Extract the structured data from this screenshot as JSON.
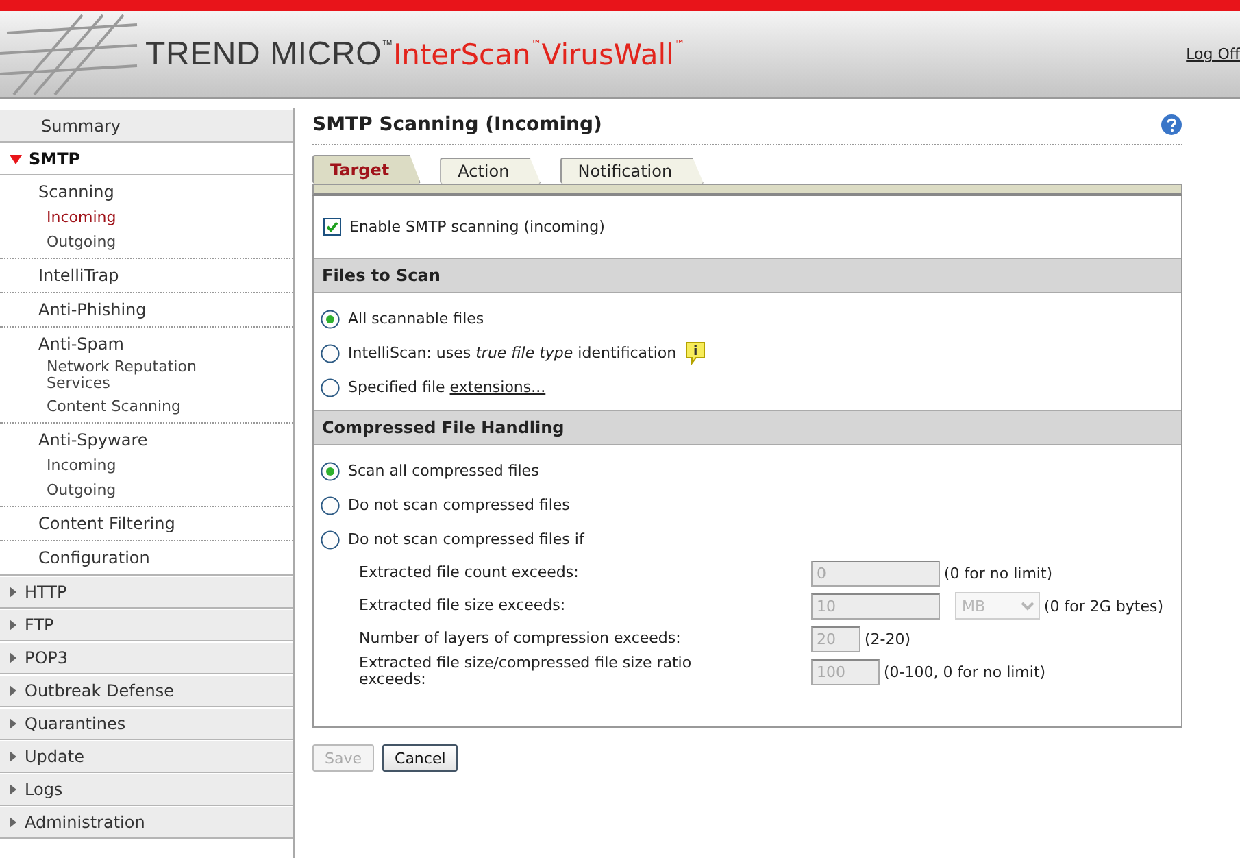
{
  "header": {
    "brand": "TREND MICRO$^{™}$",
    "product": "InterScan$^{™}$VirusWall$^{™}$",
    "log_off": "Log Off"
  },
  "sidebar": {
    "items": [
      {
        "label": "Summary",
        "kind": "page"
      },
      {
        "label": "SMTP",
        "kind": "section",
        "expanded": true,
        "children": [
          {
            "label": "Scanning",
            "selected": false,
            "children": [
              {
                "label": "Incoming",
                "selected": true
              },
              {
                "label": "Outgoing",
                "selected": false
              }
            ]
          },
          {
            "label": "IntelliTrap",
            "selected": false
          },
          {
            "label": "Anti-Phishing",
            "selected": false
          },
          {
            "label": "Anti-Spam",
            "selected": false,
            "children": [
              {
                "label": "Network Reputation Services",
                "selected": false
              },
              {
                "label": "Content Scanning",
                "selected": false
              }
            ]
          },
          {
            "label": "Anti-Spyware",
            "selected": false,
            "children": [
              {
                "label": "Incoming",
                "selected": false
              },
              {
                "label": "Outgoing",
                "selected": false
              }
            ]
          },
          {
            "label": "Content Filtering",
            "selected": false
          },
          {
            "label": "Configuration",
            "selected": false
          }
        ]
      },
      {
        "label": "HTTP",
        "kind": "section",
        "expanded": false
      },
      {
        "label": "FTP",
        "kind": "section",
        "expanded": false
      },
      {
        "label": "POP3",
        "kind": "section",
        "expanded": false
      },
      {
        "label": "Outbreak Defense",
        "kind": "section",
        "expanded": false
      },
      {
        "label": "Quarantines",
        "kind": "section",
        "expanded": false
      },
      {
        "label": "Update",
        "kind": "section",
        "expanded": false
      },
      {
        "label": "Logs",
        "kind": "section",
        "expanded": false
      },
      {
        "label": "Administration",
        "kind": "section",
        "expanded": false
      }
    ]
  },
  "page": {
    "title": "SMTP Scanning (Incoming)",
    "tabs": [
      {
        "label": "Target",
        "selected": true
      },
      {
        "label": "Action",
        "selected": false
      },
      {
        "label": "Notification",
        "selected": false
      }
    ],
    "enable": {
      "label": "Enable SMTP scanning (incoming)",
      "checked": true
    },
    "sections": [
      {
        "title": "Files to Scan",
        "options": [
          {
            "label": "All scannable files",
            "kind": "plain",
            "selected": true
          },
          {
            "label": "IntelliScan: uses *true file type* identification",
            "kind": "info",
            "selected": false
          },
          {
            "label": "Specified file ",
            "link": "extensions...",
            "kind": "link",
            "selected": false
          }
        ]
      },
      {
        "title": "Compressed File Handling",
        "options": [
          {
            "label": "Scan all compressed files",
            "kind": "plain",
            "selected": true
          },
          {
            "label": "Do not scan compressed files",
            "kind": "plain",
            "selected": false
          },
          {
            "label": "Do not scan compressed files if",
            "kind": "plain",
            "selected": false
          }
        ],
        "fields": [
          {
            "label": "Extracted file count exceeds:",
            "value": "0",
            "hint": "(0 for no limit)",
            "disabled": true
          },
          {
            "label": "Extracted file size exceeds:",
            "value": "10",
            "unit": "MB",
            "hint": "(0 for 2G bytes)",
            "disabled": true
          },
          {
            "label": "Number of layers of compression exceeds:",
            "value": "20",
            "hint": "(2-20)",
            "disabled": true
          },
          {
            "label": "Extracted file size/compressed file size ratio exceeds:",
            "value": "100",
            "hint": "(0-100, 0 for no limit)",
            "disabled": true
          }
        ]
      }
    ]
  },
  "buttons": [
    {
      "label": "Save",
      "disabled": true
    },
    {
      "label": "Cancel",
      "disabled": false
    }
  ]
}
